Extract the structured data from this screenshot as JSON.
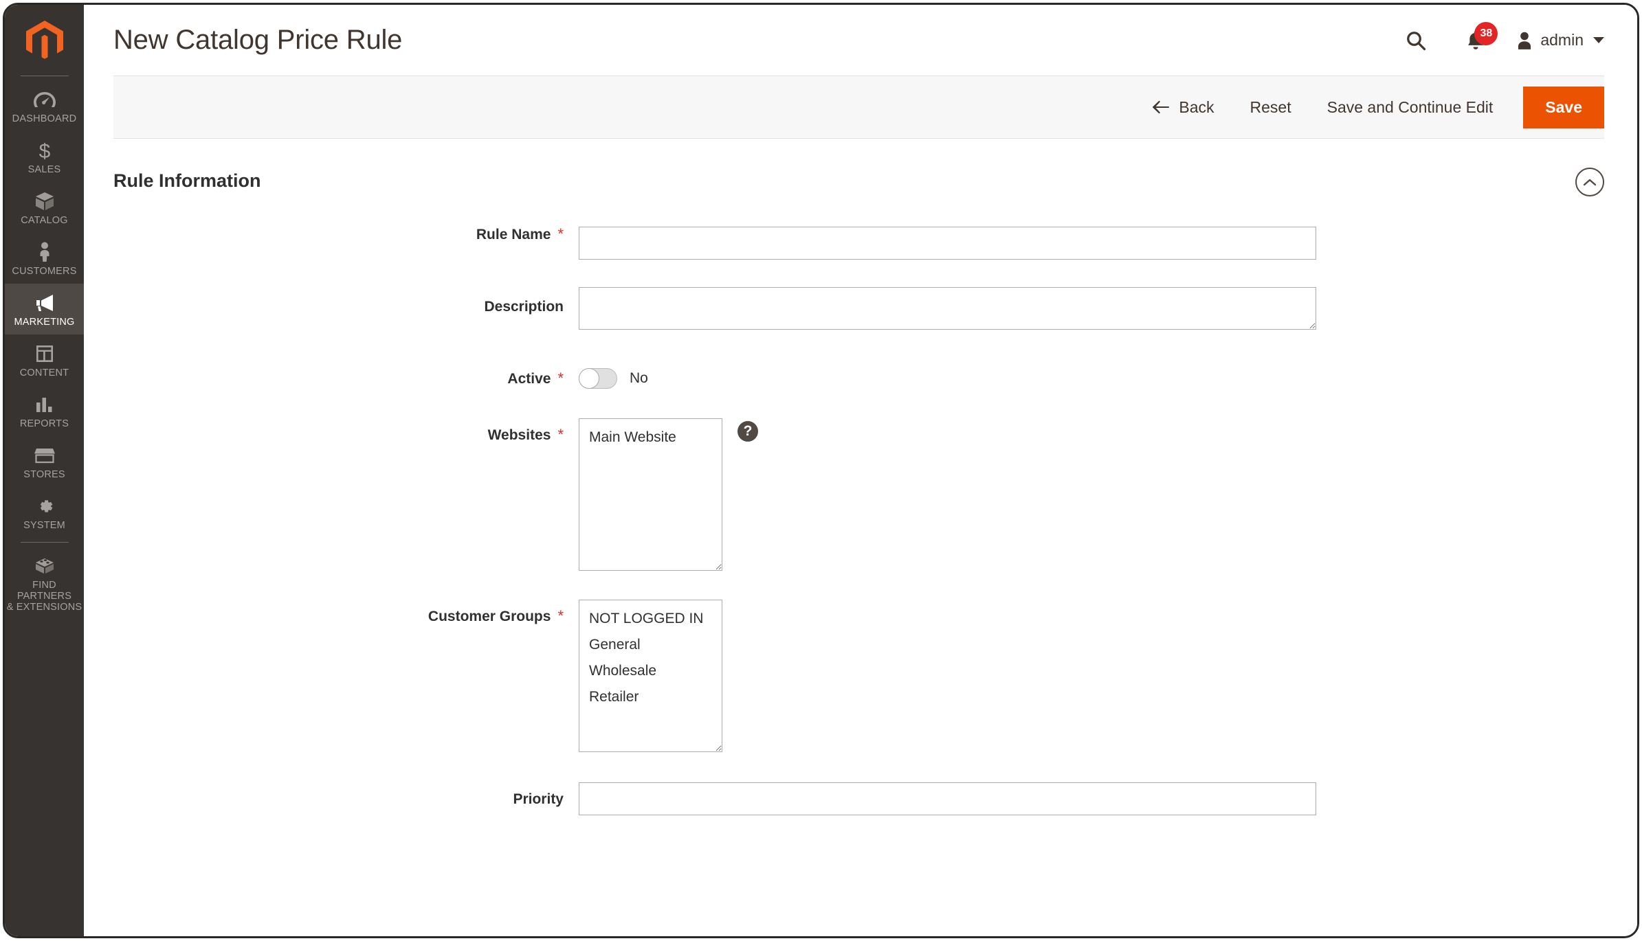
{
  "header": {
    "title": "New Catalog Price Rule",
    "search_icon": "search-icon",
    "notifications_icon": "bell-icon",
    "notifications_count": "38",
    "admin_name": "admin",
    "admin_icon": "user-icon",
    "caret_icon": "chevron-down-icon"
  },
  "sidebar": {
    "logo": "magento-logo",
    "items": [
      {
        "label": "DASHBOARD",
        "icon": "dashboard-icon",
        "active": false
      },
      {
        "label": "SALES",
        "icon": "dollar-icon",
        "active": false
      },
      {
        "label": "CATALOG",
        "icon": "box-icon",
        "active": false
      },
      {
        "label": "CUSTOMERS",
        "icon": "person-icon",
        "active": false
      },
      {
        "label": "MARKETING",
        "icon": "megaphone-icon",
        "active": true
      },
      {
        "label": "CONTENT",
        "icon": "layout-icon",
        "active": false
      },
      {
        "label": "REPORTS",
        "icon": "bar-chart-icon",
        "active": false
      },
      {
        "label": "STORES",
        "icon": "storefront-icon",
        "active": false
      },
      {
        "label": "SYSTEM",
        "icon": "gear-icon",
        "active": false
      },
      {
        "label": "FIND PARTNERS\n& EXTENSIONS",
        "icon": "puzzle-block-icon",
        "active": false
      }
    ]
  },
  "toolbar": {
    "back_label": "Back",
    "back_icon": "arrow-left-icon",
    "reset_label": "Reset",
    "save_continue_label": "Save and Continue Edit",
    "save_label": "Save"
  },
  "section": {
    "title": "Rule Information",
    "collapse_icon": "chevron-up-icon"
  },
  "form": {
    "rule_name": {
      "label": "Rule Name",
      "required": "*",
      "value": "",
      "placeholder": ""
    },
    "description": {
      "label": "Description",
      "required": "",
      "value": "",
      "placeholder": ""
    },
    "active": {
      "label": "Active",
      "required": "*",
      "state_label": "No",
      "checked": false
    },
    "websites": {
      "label": "Websites",
      "required": "*",
      "options": [
        "Main Website"
      ],
      "help_icon": "question-mark-icon",
      "help_glyph": "?"
    },
    "customer_groups": {
      "label": "Customer Groups",
      "required": "*",
      "options": [
        "NOT LOGGED IN",
        "General",
        "Wholesale",
        "Retailer"
      ]
    },
    "priority": {
      "label": "Priority",
      "required": "",
      "value": "",
      "placeholder": ""
    }
  },
  "colors": {
    "brand_orange": "#eb5202",
    "sidebar_bg": "#373330",
    "sidebar_active_bg": "#4f4945",
    "badge_red": "#e22626",
    "required_red": "#e02b27",
    "text_dark": "#303030",
    "toolbar_bg": "#f7f7f7"
  }
}
